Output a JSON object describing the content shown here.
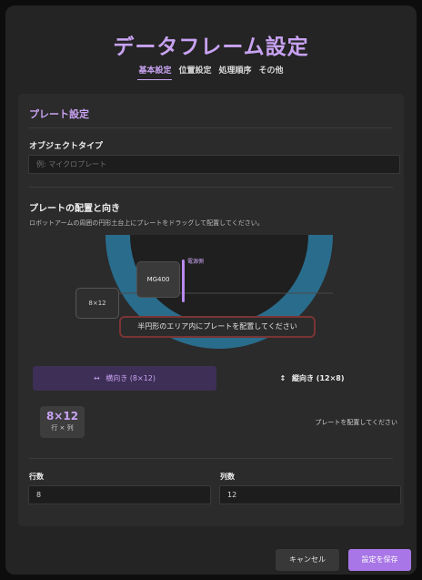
{
  "dialog": {
    "title": "データフレーム設定"
  },
  "tabs": [
    {
      "label": "基本設定",
      "active": true
    },
    {
      "label": "位置設定",
      "active": false
    },
    {
      "label": "処理順序",
      "active": false
    },
    {
      "label": "その他",
      "active": false
    }
  ],
  "plate_settings": {
    "section_title": "プレート設定",
    "object_type": {
      "label": "オブジェクトタイプ",
      "placeholder": "例: マイクロプレート",
      "value": ""
    }
  },
  "placement": {
    "heading": "プレートの配置と向き",
    "description": "ロボットアームの周囲の円形土台上にプレートをドラッグして配置してください。",
    "instrument_label": "MG400",
    "power_label": "電源側",
    "plate_label": "8×12",
    "area_message": "半円形のエリア内にプレートを配置してください"
  },
  "orientation": {
    "landscape": {
      "icon": "↔",
      "label": "横向き (8×12)",
      "selected": true
    },
    "portrait": {
      "icon": "↕",
      "label": "縦向き (12×8)",
      "selected": false
    }
  },
  "summary": {
    "size": "8×12",
    "unit": "行 × 列",
    "status": "プレートを配置してください"
  },
  "grid": {
    "rows": {
      "label": "行数",
      "value": "8"
    },
    "cols": {
      "label": "列数",
      "value": "12"
    }
  },
  "footer": {
    "cancel_label": "キャンセル",
    "save_label": "設定を保存"
  },
  "colors": {
    "accent": "#c9a3f3",
    "arena_ring": "#2a6c8c",
    "warning_border": "#7a3434",
    "save_button": "#a876e6"
  }
}
